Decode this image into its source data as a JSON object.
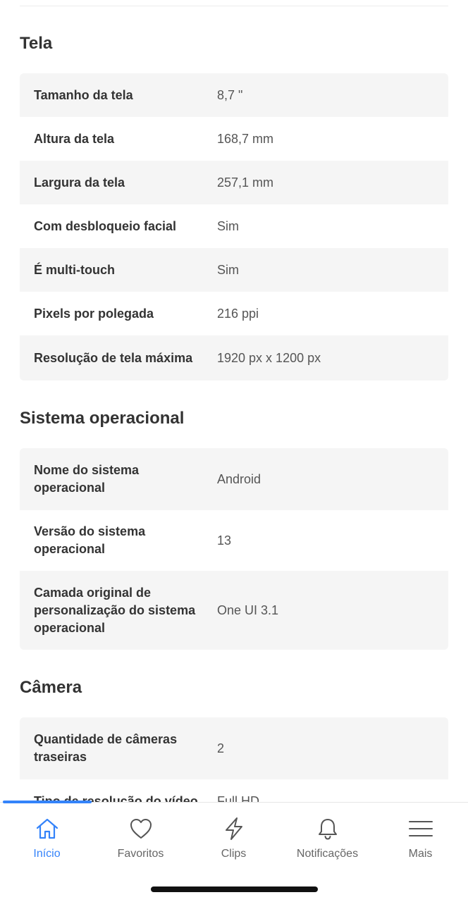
{
  "sections": [
    {
      "title": "Tela",
      "rows": [
        {
          "label": "Tamanho da tela",
          "value": "8,7 \""
        },
        {
          "label": "Altura da tela",
          "value": "168,7 mm"
        },
        {
          "label": "Largura da tela",
          "value": "257,1 mm"
        },
        {
          "label": "Com desbloqueio facial",
          "value": "Sim"
        },
        {
          "label": "É multi-touch",
          "value": "Sim"
        },
        {
          "label": "Pixels por polegada",
          "value": "216 ppi"
        },
        {
          "label": "Resolução de tela máxima",
          "value": "1920 px x 1200 px"
        }
      ]
    },
    {
      "title": "Sistema operacional",
      "rows": [
        {
          "label": "Nome do sistema operacional",
          "value": "Android"
        },
        {
          "label": "Versão do sistema operacional",
          "value": "13"
        },
        {
          "label": "Camada original de personalização do sistema operacional",
          "value": "One UI 3.1"
        }
      ]
    },
    {
      "title": "Câmera",
      "rows": [
        {
          "label": "Quantidade de câmeras traseiras",
          "value": "2"
        },
        {
          "label": "Tipo de resolução do vídeo",
          "value": "Full HD"
        }
      ]
    }
  ],
  "bottom_nav": {
    "active_color": "#3483fa",
    "items": [
      {
        "label": "Início",
        "icon": "home-icon",
        "active": true
      },
      {
        "label": "Favoritos",
        "icon": "heart-icon",
        "active": false
      },
      {
        "label": "Clips",
        "icon": "clips-icon",
        "active": false
      },
      {
        "label": "Notificações",
        "icon": "bell-icon",
        "active": false
      },
      {
        "label": "Mais",
        "icon": "menu-icon",
        "active": false
      }
    ]
  }
}
